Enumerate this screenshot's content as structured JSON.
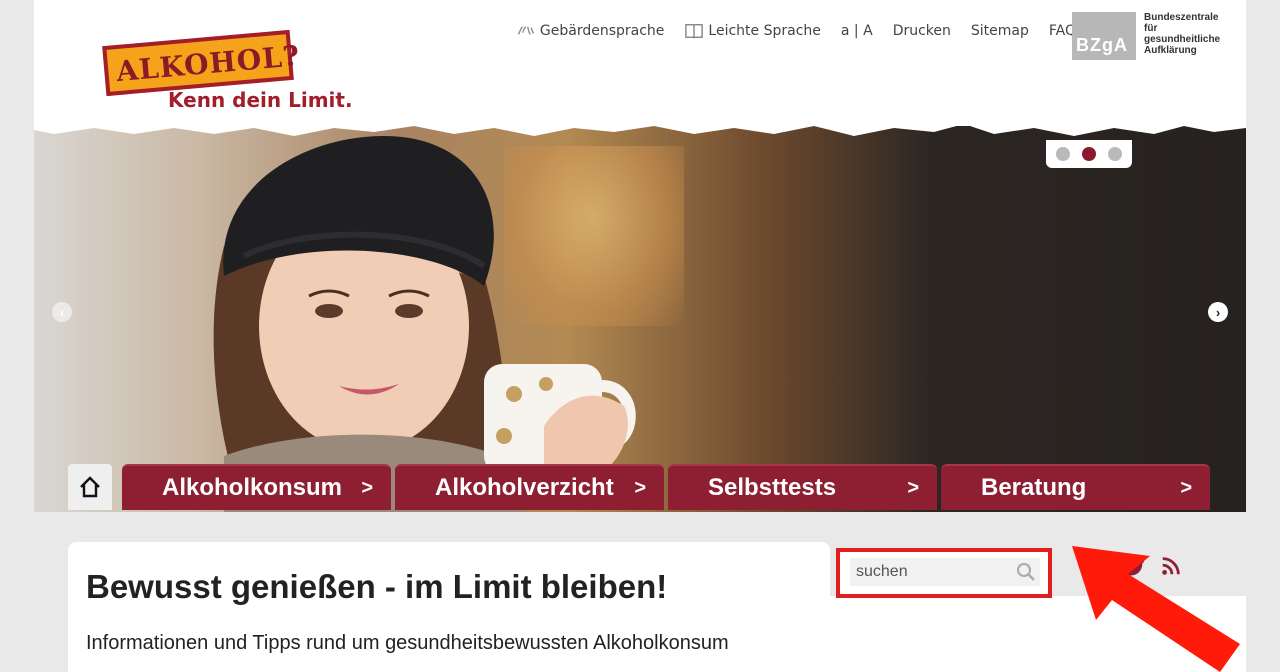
{
  "topnav": {
    "sign_language": "Gebärdensprache",
    "easy_language": "Leichte Sprache",
    "font_size": "a | A",
    "print": "Drucken",
    "sitemap": "Sitemap",
    "faq": "FAQ"
  },
  "brand": {
    "logo_text": "ALKOHOL?",
    "logo_sub": "Kenn dein Limit.",
    "partner_logo": "BZgA",
    "partner_name": "Bundeszentrale für gesundheitliche Aufklärung"
  },
  "slider": {
    "dots": 3,
    "active_index": 1
  },
  "main_nav": [
    {
      "label": "Alkoholkonsum",
      "chevron": ">"
    },
    {
      "label": "Alkoholverzicht",
      "chevron": ">"
    },
    {
      "label": "Selbsttests",
      "chevron": ">"
    },
    {
      "label": "Beratung",
      "chevron": ">"
    }
  ],
  "search": {
    "placeholder": "suchen"
  },
  "content": {
    "title": "Bewusst genießen - im Limit bleiben!",
    "subtitle": "Informationen und Tipps rund um gesundheitsbewussten Alkoholkonsum"
  },
  "colors": {
    "brand_red": "#8e1f33",
    "highlight_red": "#e31e1e",
    "logo_orange": "#f5a31a"
  },
  "icons": [
    "sign-language-icon",
    "easy-language-icon",
    "home-icon",
    "search-icon",
    "facebook-icon",
    "twitter-icon",
    "rss-icon"
  ]
}
